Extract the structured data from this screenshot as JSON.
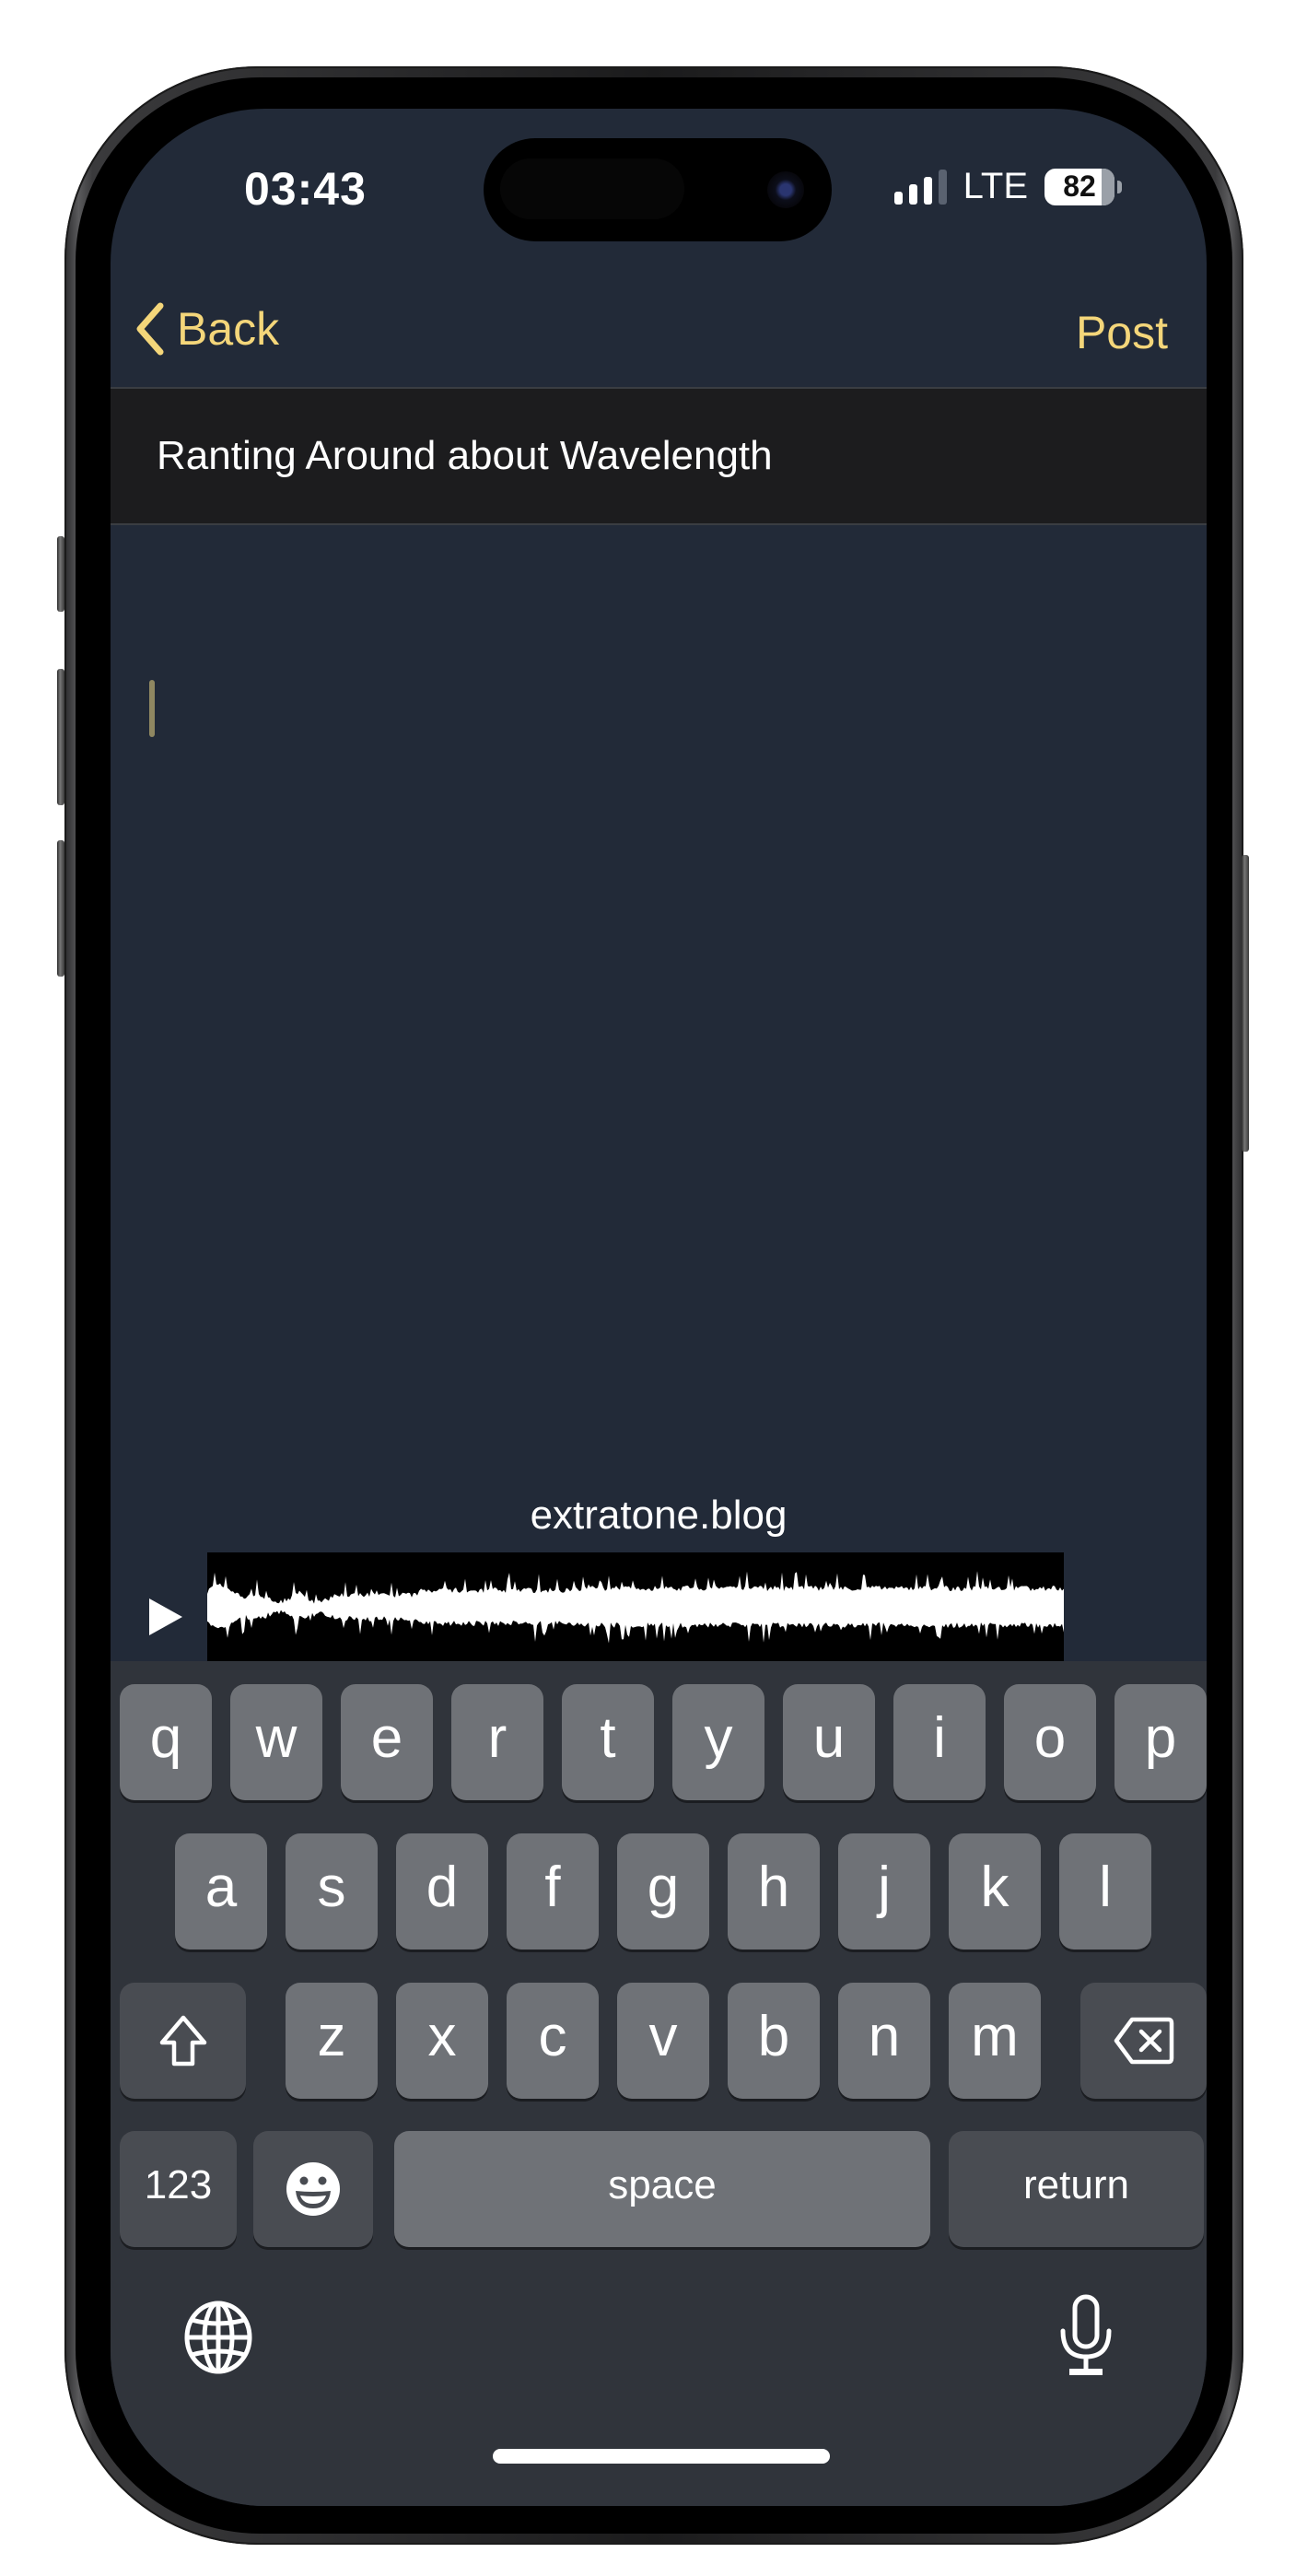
{
  "status_bar": {
    "time": "03:43",
    "network": "LTE",
    "signal_bars_active": 3,
    "signal_bars_total": 4,
    "battery_percent": 82
  },
  "nav": {
    "back_label": "Back",
    "post_label": "Post",
    "accent_color": "#f4d67a"
  },
  "post": {
    "title": "Ranting Around about Wavelength",
    "body": ""
  },
  "audio_embed": {
    "title": "extratone.blog",
    "play_icon": "play-icon"
  },
  "keyboard": {
    "row1": [
      "q",
      "w",
      "e",
      "r",
      "t",
      "y",
      "u",
      "i",
      "o",
      "p"
    ],
    "row2": [
      "a",
      "s",
      "d",
      "f",
      "g",
      "h",
      "j",
      "k",
      "l"
    ],
    "row3": [
      "z",
      "x",
      "c",
      "v",
      "b",
      "n",
      "m"
    ],
    "numbers_label": "123",
    "space_label": "space",
    "return_label": "return",
    "shift_icon": "shift-icon",
    "delete_icon": "delete-icon",
    "emoji_icon": "emoji-icon",
    "globe_icon": "globe-icon",
    "mic_icon": "microphone-icon"
  }
}
